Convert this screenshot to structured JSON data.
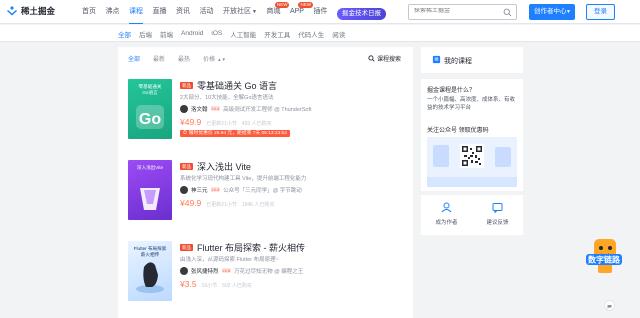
{
  "header": {
    "logo_text": "稀土掘金",
    "nav": [
      {
        "label": "首页",
        "active": false
      },
      {
        "label": "沸点",
        "active": false
      },
      {
        "label": "课程",
        "active": true
      },
      {
        "label": "直播",
        "active": false
      },
      {
        "label": "资讯",
        "active": false
      },
      {
        "label": "活动",
        "active": false
      },
      {
        "label": "开放社区",
        "active": false,
        "has_dropdown": true
      },
      {
        "label": "商城",
        "active": false,
        "badge": "NEW"
      },
      {
        "label": "APP",
        "active": false,
        "badge": "NEW"
      },
      {
        "label": "插件",
        "active": false
      }
    ],
    "promo_label": "掘金技术日报",
    "search_placeholder": "探索稀土掘金",
    "creator_button": "创作者中心",
    "login_button": "登录"
  },
  "categories": [
    {
      "label": "全部",
      "active": true
    },
    {
      "label": "后端",
      "active": false
    },
    {
      "label": "前端",
      "active": false
    },
    {
      "label": "Android",
      "active": false
    },
    {
      "label": "iOS",
      "active": false
    },
    {
      "label": "人工智能",
      "active": false
    },
    {
      "label": "开发工具",
      "active": false
    },
    {
      "label": "代码人生",
      "active": false
    },
    {
      "label": "阅读",
      "active": false
    }
  ],
  "filters": {
    "items": [
      {
        "label": "全部",
        "active": true
      },
      {
        "label": "最新",
        "active": false
      },
      {
        "label": "最热",
        "active": false
      },
      {
        "label": "价格",
        "active": false,
        "sortable": true
      }
    ],
    "course_search_label": "课程搜索"
  },
  "courses": [
    {
      "tag": "新品",
      "title": "零基础通关 Go 语言",
      "desc": "2大部分、10大技能，全解Go语言语法",
      "author": "洛文翰",
      "level": "LV.4",
      "author_role": "高级测试开发工程师 @ ThunderSoft",
      "price": "¥49.9",
      "updated": "已更新21小节",
      "learners": "493 人已购买",
      "discount": "限时优惠价 29.94 元，距结束 7天 06:13:23:52",
      "cover_title": "零基础通关\nGo语言",
      "cover_colors": [
        "#23c69a",
        "#1aa57f"
      ]
    },
    {
      "tag": "新品",
      "title": "深入浅出 Vite",
      "desc": "系统化学习现代构建工具 Vite，提升前端工程化能力",
      "author": "神三元",
      "level": "LV.4",
      "author_role": "公众号「三元同学」@ 字节跳动",
      "price": "¥49.9",
      "updated": "已更新21小节",
      "learners": "1946 人已购买",
      "discount": "",
      "cover_title": "深入浅出Vite",
      "cover_colors": [
        "#9c4cf5",
        "#6b2ecf"
      ]
    },
    {
      "tag": "新品",
      "title": "Flutter 布局探索 - 薪火相传",
      "desc": "由浅入深，从源码探索 Flutter 布局原理~",
      "author": "张风捷特烈",
      "level": "LV.5",
      "author_role": "万花过尽知无物 @ 编程之王",
      "price": "¥3.5",
      "updated": "16小节",
      "learners": "502 人已购买",
      "discount": "",
      "cover_title": "Flutter 布局探索\n薪火相传",
      "cover_colors": [
        "#e9f4ff",
        "#bcd9ff"
      ]
    }
  ],
  "sidebar": {
    "my_course": "我的课程",
    "promo_title": "掘金课程是什么？",
    "promo_desc": "一个小篇幅、高浓度、成体系、有收益的技术学习平台",
    "follow_text": "关注公众号 领取优惠码",
    "actions": [
      {
        "label": "成为作者"
      },
      {
        "label": "建议反馈"
      }
    ]
  },
  "mascot_label": "数字链路"
}
